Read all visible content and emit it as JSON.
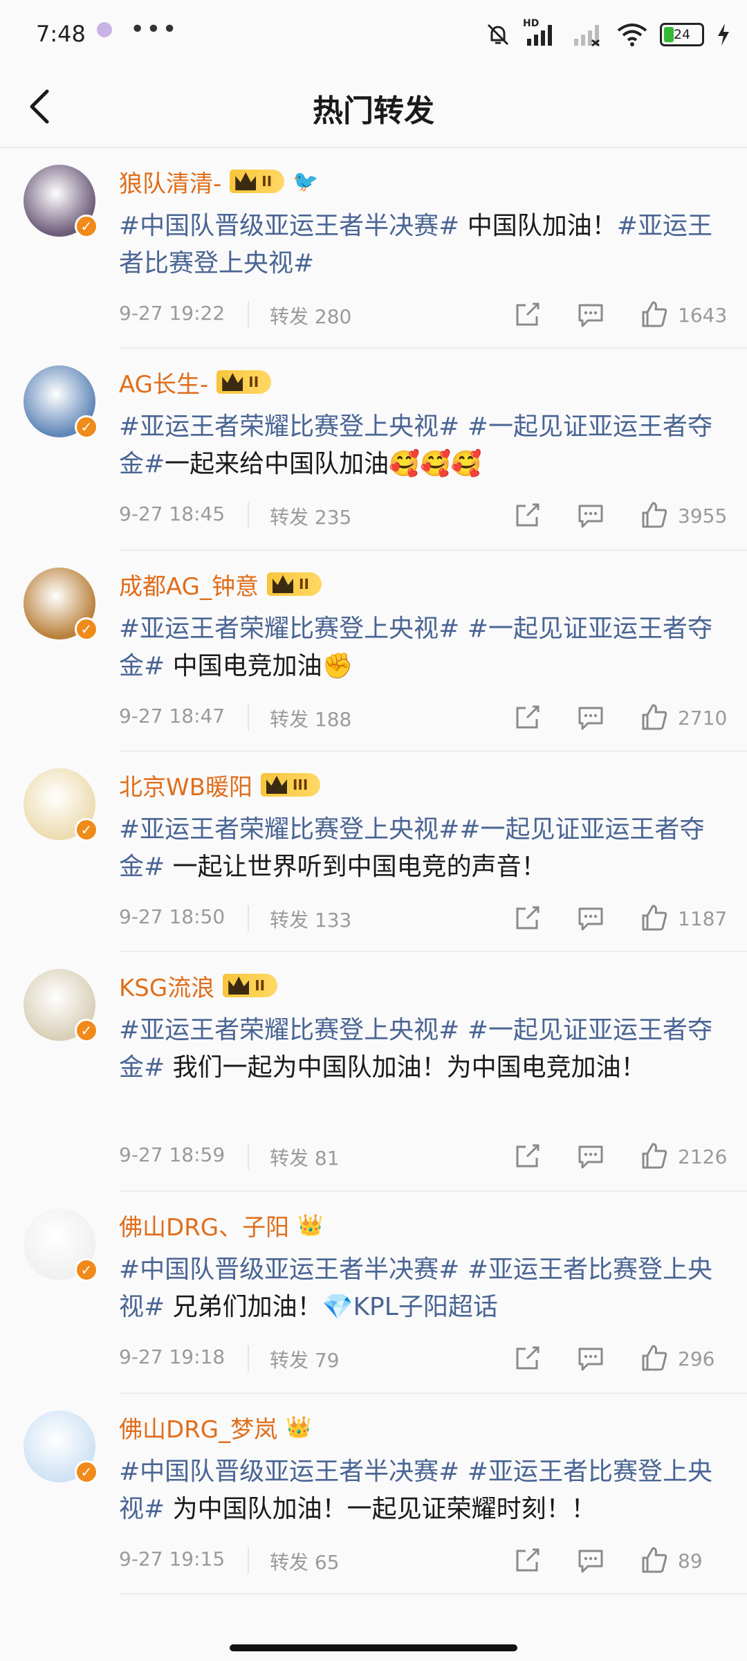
{
  "status_bar": {
    "time": "7:48",
    "dots": "•••",
    "hd_label": "HD",
    "battery": "24"
  },
  "header": {
    "title": "热门转发",
    "back_icon": "chevron-left-icon"
  },
  "posts": [
    {
      "user": "狼队清清-",
      "rank": "II",
      "extra_badge": "🐦",
      "avatar_color": "#6d5b7a",
      "segments": [
        {
          "text": "#中国队晋级亚运王者半决赛#",
          "tag": true
        },
        {
          "text": " 中国队加油！",
          "tag": false
        },
        {
          "text": "#亚运王者比赛登上央视#",
          "tag": true
        }
      ],
      "time": "9-27 19:22",
      "reposts": "转发 280",
      "likes": "1643"
    },
    {
      "user": "AG长生-",
      "rank": "II",
      "extra_badge": "",
      "avatar_color": "#5f86b8",
      "segments": [
        {
          "text": "#亚运王者荣耀比赛登上央视#",
          "tag": true
        },
        {
          "text": " ",
          "tag": false
        },
        {
          "text": "#一起见证亚运王者夺金#",
          "tag": true
        },
        {
          "text": "一起来给中国队加油🥰🥰🥰",
          "tag": false
        }
      ],
      "time": "9-27 18:45",
      "reposts": "转发 235",
      "likes": "3955"
    },
    {
      "user": "成都AG_钟意",
      "rank": "II",
      "extra_badge": "",
      "avatar_color": "#b9803a",
      "segments": [
        {
          "text": "#亚运王者荣耀比赛登上央视#",
          "tag": true
        },
        {
          "text": " ",
          "tag": false
        },
        {
          "text": "#一起见证亚运王者夺金#",
          "tag": true
        },
        {
          "text": " 中国电竞加油✊",
          "tag": false
        }
      ],
      "time": "9-27 18:47",
      "reposts": "转发 188",
      "likes": "2710"
    },
    {
      "user": "北京WB暖阳",
      "rank": "III",
      "extra_badge": "",
      "avatar_color": "#ecdcb0",
      "segments": [
        {
          "text": "#亚运王者荣耀比赛登上央视##一起见证亚运王者夺金#",
          "tag": true
        },
        {
          "text": " 一起让世界听到中国电竞的声音！",
          "tag": false
        }
      ],
      "time": "9-27 18:50",
      "reposts": "转发 133",
      "likes": "1187"
    },
    {
      "user": "KSG流浪",
      "rank": "II",
      "extra_badge": "",
      "avatar_color": "#d9cfb8",
      "segments": [
        {
          "text": "#亚运王者荣耀比赛登上央视#",
          "tag": true
        },
        {
          "text": " ",
          "tag": false
        },
        {
          "text": "#一起见证亚运王者夺金#",
          "tag": true
        },
        {
          "text": " 我们一起为中国队加油！为中国电竞加油！",
          "tag": false
        }
      ],
      "time": "9-27 18:59",
      "reposts": "转发 81",
      "likes": "2126"
    },
    {
      "user": "佛山DRG、子阳",
      "rank": "",
      "extra_badge": "👑",
      "avatar_color": "#f0f0f0",
      "segments": [
        {
          "text": "#中国队晋级亚运王者半决赛#",
          "tag": true
        },
        {
          "text": " ",
          "tag": false
        },
        {
          "text": "#亚运王者比赛登上央视#",
          "tag": true
        },
        {
          "text": " 兄弟们加油！",
          "tag": false
        },
        {
          "text": "💎KPL子阳超话",
          "tag": true
        }
      ],
      "time": "9-27 19:18",
      "reposts": "转发 79",
      "likes": "296"
    },
    {
      "user": "佛山DRG_梦岚",
      "rank": "",
      "extra_badge": "👑",
      "avatar_color": "#cfe2f5",
      "segments": [
        {
          "text": "#中国队晋级亚运王者半决赛#",
          "tag": true
        },
        {
          "text": " ",
          "tag": false
        },
        {
          "text": "#亚运王者比赛登上央视#",
          "tag": true
        },
        {
          "text": " 为中国队加油！一起见证荣耀时刻！！",
          "tag": false
        }
      ],
      "time": "9-27 19:15",
      "reposts": "转发 65",
      "likes": "89"
    }
  ],
  "icons": {
    "share": "share-icon",
    "comment": "comment-icon",
    "like": "thumbs-up-icon",
    "verified": "verified-v-icon"
  },
  "colors": {
    "username": "#e06d1a",
    "hashtag": "#4a6594",
    "meta": "#9a9a9a",
    "verified_badge": "#f08a1a"
  }
}
